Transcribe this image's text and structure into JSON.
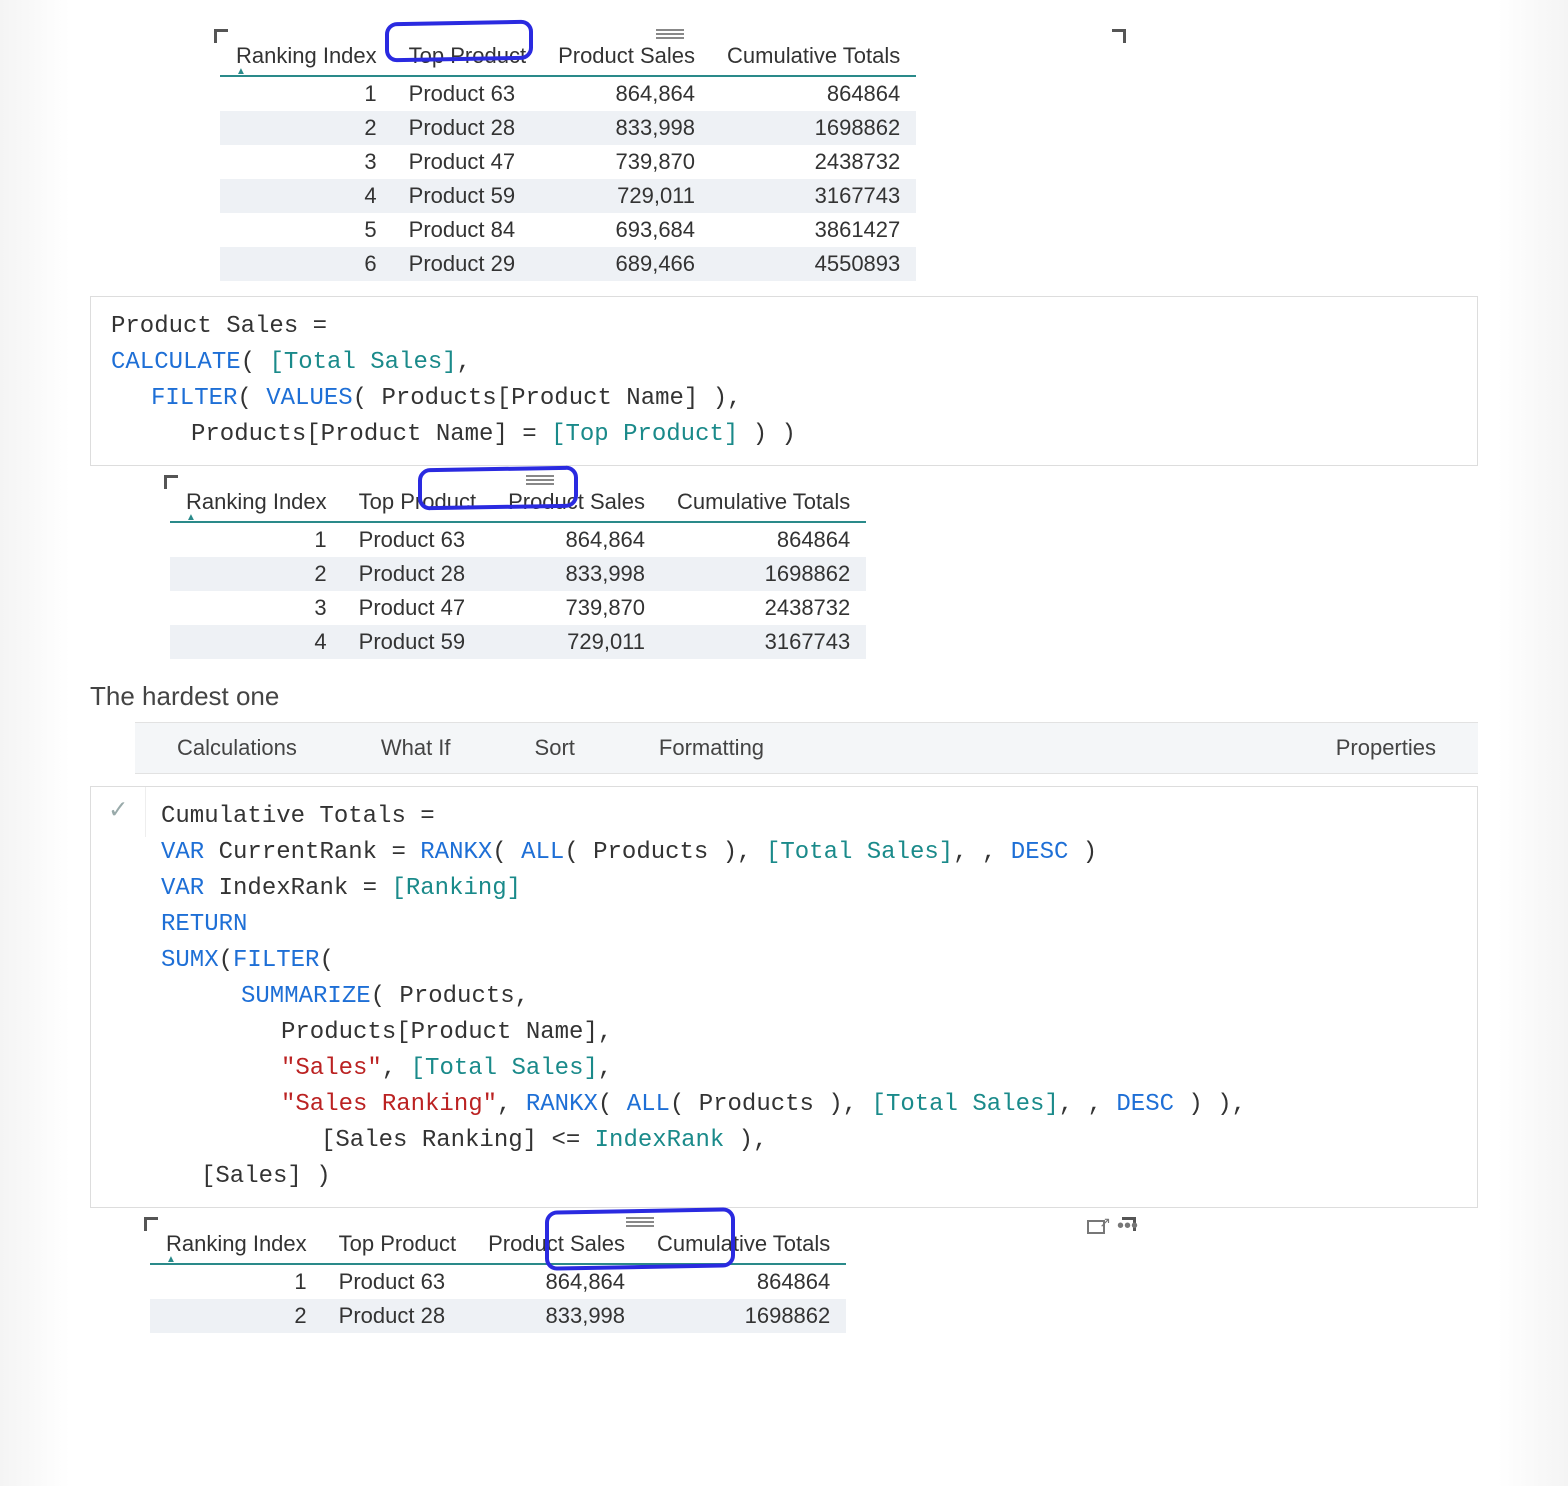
{
  "table1": {
    "headers": [
      "Ranking Index",
      "Top Product",
      "Product Sales",
      "Cumulative Totals"
    ],
    "rows": [
      {
        "rank": "1",
        "prod": "Product 63",
        "sales": "864,864",
        "cum": "864864"
      },
      {
        "rank": "2",
        "prod": "Product 28",
        "sales": "833,998",
        "cum": "1698862"
      },
      {
        "rank": "3",
        "prod": "Product 47",
        "sales": "739,870",
        "cum": "2438732"
      },
      {
        "rank": "4",
        "prod": "Product 59",
        "sales": "729,011",
        "cum": "3167743"
      },
      {
        "rank": "5",
        "prod": "Product 84",
        "sales": "693,684",
        "cum": "3861427"
      },
      {
        "rank": "6",
        "prod": "Product 29",
        "sales": "689,466",
        "cum": "4550893"
      }
    ]
  },
  "formula1": {
    "l1a": "Product Sales =",
    "l2a": "CALCULATE",
    "l2b": "( ",
    "l2c": "[Total Sales]",
    "l2d": ",",
    "l3a": "FILTER",
    "l3b": "( ",
    "l3c": "VALUES",
    "l3d": "( Products[Product Name] ),",
    "l4a": "Products[Product Name] = ",
    "l4b": "[Top Product]",
    "l4c": " ) )"
  },
  "table2": {
    "headers": [
      "Ranking Index",
      "Top Product",
      "Product Sales",
      "Cumulative Totals"
    ],
    "rows": [
      {
        "rank": "1",
        "prod": "Product 63",
        "sales": "864,864",
        "cum": "864864"
      },
      {
        "rank": "2",
        "prod": "Product 28",
        "sales": "833,998",
        "cum": "1698862"
      },
      {
        "rank": "3",
        "prod": "Product 47",
        "sales": "739,870",
        "cum": "2438732"
      },
      {
        "rank": "4",
        "prod": "Product 59",
        "sales": "729,011",
        "cum": "3167743"
      }
    ]
  },
  "heading": "The hardest one",
  "tabs": [
    "Calculations",
    "What If",
    "Sort",
    "Formatting",
    "Properties"
  ],
  "formula2": {
    "l1": "Cumulative Totals =",
    "l2a": "VAR",
    "l2b": " CurrentRank = ",
    "l2c": "RANKX",
    "l2d": "( ",
    "l2e": "ALL",
    "l2f": "( Products ), ",
    "l2g": "[Total Sales]",
    "l2h": ", , ",
    "l2i": "DESC",
    "l2j": " )",
    "l3a": "VAR",
    "l3b": " IndexRank = ",
    "l3c": "[Ranking]",
    "l4": "RETURN",
    "l5a": "SUMX",
    "l5b": "(",
    "l5c": "FILTER",
    "l5d": "(",
    "l6a": "SUMMARIZE",
    "l6b": "( Products,",
    "l7": "Products[Product Name],",
    "l8a": "\"Sales\"",
    "l8b": ", ",
    "l8c": "[Total Sales]",
    "l8d": ",",
    "l9a": "\"Sales Ranking\"",
    "l9b": ", ",
    "l9c": "RANKX",
    "l9d": "( ",
    "l9e": "ALL",
    "l9f": "( Products ), ",
    "l9g": "[Total Sales]",
    "l9h": ", , ",
    "l9i": "DESC",
    "l9j": " ) ),",
    "l10a": "[Sales Ranking] <= ",
    "l10b": "IndexRank",
    "l10c": " ),",
    "l11": "[Sales] )"
  },
  "table3": {
    "headers": [
      "Ranking Index",
      "Top Product",
      "Product Sales",
      "Cumulative Totals"
    ],
    "rows": [
      {
        "rank": "1",
        "prod": "Product 63",
        "sales": "864,864",
        "cum": "864864"
      },
      {
        "rank": "2",
        "prod": "Product 28",
        "sales": "833,998",
        "cum": "1698862"
      }
    ]
  },
  "chart_data": {
    "type": "table",
    "title": "Top product ranking with sales and cumulative totals",
    "columns": [
      "Ranking Index",
      "Top Product",
      "Product Sales",
      "Cumulative Totals"
    ],
    "rows": [
      [
        1,
        "Product 63",
        864864,
        864864
      ],
      [
        2,
        "Product 28",
        833998,
        1698862
      ],
      [
        3,
        "Product 47",
        739870,
        2438732
      ],
      [
        4,
        "Product 59",
        729011,
        3167743
      ],
      [
        5,
        "Product 84",
        693684,
        3861427
      ],
      [
        6,
        "Product 29",
        689466,
        4550893
      ]
    ]
  }
}
